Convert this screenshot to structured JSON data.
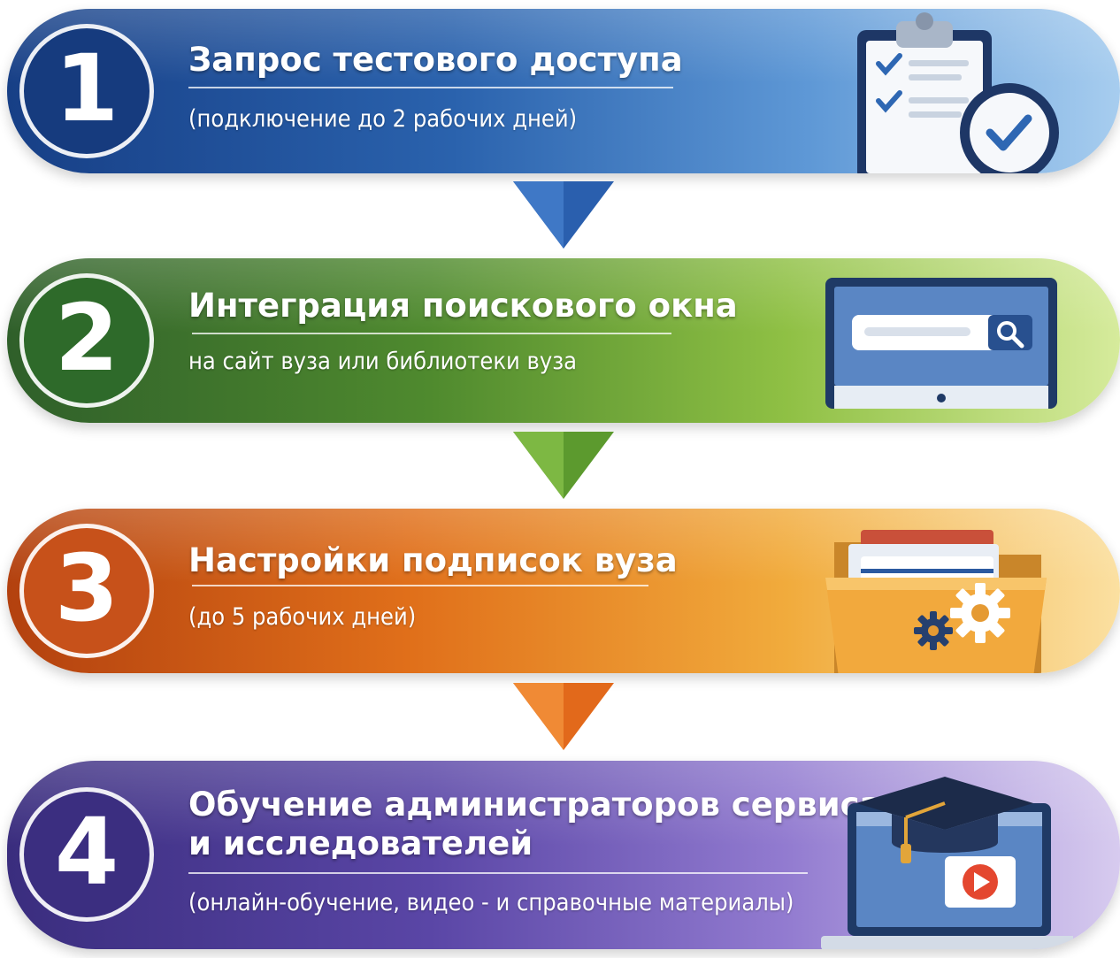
{
  "steps": [
    {
      "number": "1",
      "title": "Запрос тестового доступа",
      "subtitle": "(подключение до 2 рабочих дней)",
      "icon": "clipboard-clock-icon",
      "color": "#1f4f99"
    },
    {
      "number": "2",
      "title": "Интеграция поискового окна",
      "subtitle": "на сайт вуза или библиотеки вуза",
      "icon": "monitor-search-icon",
      "color": "#3f7a2c"
    },
    {
      "number": "3",
      "title": "Настройки подписок вуза",
      "subtitle": "(до 5 рабочих дней)",
      "icon": "folder-gears-icon",
      "color": "#d9631a"
    },
    {
      "number": "4",
      "title_line1": "Обучение администраторов сервиса",
      "title_line2": "и исследователей",
      "subtitle": "(онлайн-обучение, видео - и справочные материалы)",
      "icon": "laptop-graduation-video-icon",
      "color": "#4a3a96"
    }
  ],
  "connectors": [
    {
      "from": "1",
      "to": "2",
      "color": "#2a5fae"
    },
    {
      "from": "2",
      "to": "3",
      "color": "#5c9a2e"
    },
    {
      "from": "3",
      "to": "4",
      "color": "#e2691b"
    }
  ]
}
